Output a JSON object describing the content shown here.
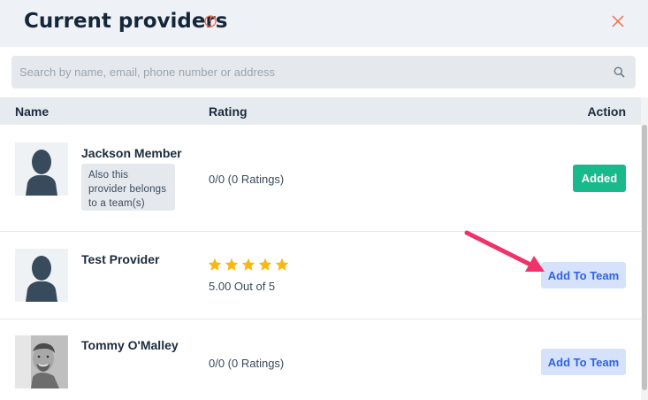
{
  "dialog": {
    "title": "Current providers",
    "info_icon": "info-circle-icon",
    "close_icon": "close-x-icon",
    "accent_color": "#ef6b4a"
  },
  "search": {
    "value": "",
    "placeholder": "Search by name, email, phone number or address",
    "icon": "search-icon"
  },
  "table": {
    "columns": {
      "name": "Name",
      "rating": "Rating",
      "action": "Action"
    },
    "rows": [
      {
        "name": "Jackson Member",
        "avatar": "placeholder-person-icon",
        "team_note": "Also this provider belongs to a team(s)",
        "rating_text": "0/0 (0 Ratings)",
        "stars": null,
        "action_label": "Added",
        "action_color": "#18b98a"
      },
      {
        "name": "Test Provider",
        "avatar": "placeholder-person-icon",
        "team_note": null,
        "rating_text": "5.00 Out of 5",
        "stars": 5,
        "action_label": "Add To Team",
        "action_color": "#2f63e0"
      },
      {
        "name": "Tommy O'Malley",
        "avatar": "photo",
        "team_note": null,
        "rating_text": "0/0 (0 Ratings)",
        "stars": null,
        "action_label": "Add To Team",
        "action_color": "#2f63e0"
      }
    ]
  },
  "annotation": {
    "arrow_color": "#f0326a",
    "points_to": "Add To Team"
  },
  "star_color": "#f7b816"
}
